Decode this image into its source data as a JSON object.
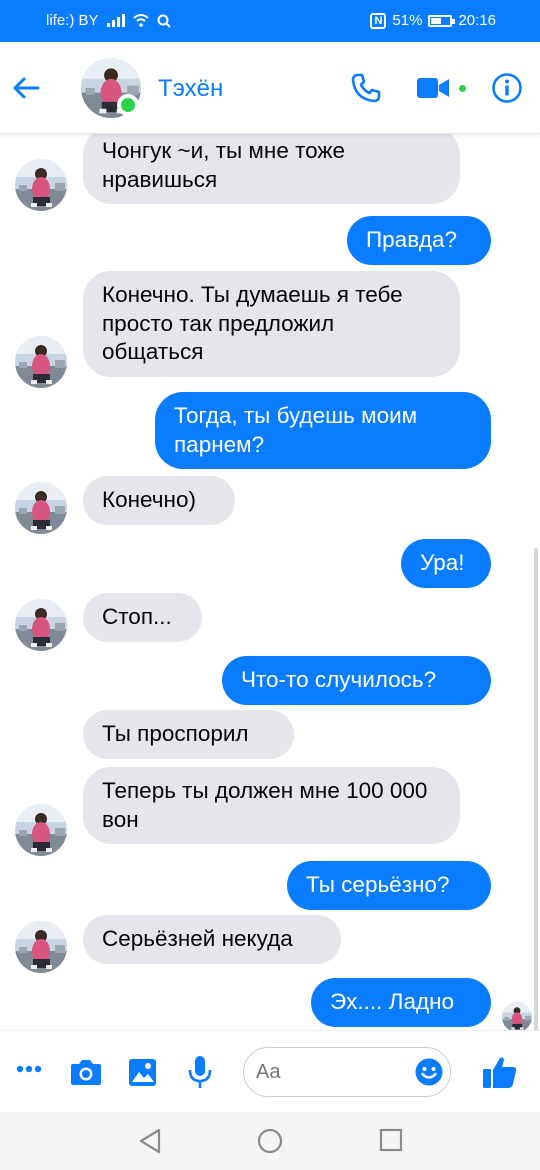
{
  "status_bar": {
    "carrier": "life:) BY",
    "battery": "51%",
    "battery_level": 0.51,
    "time": "20:16"
  },
  "header": {
    "contact_name": "Тэхён",
    "icons": [
      "back-arrow-icon",
      "phone-icon",
      "video-camera-icon",
      "info-icon"
    ]
  },
  "colors": {
    "accent": "#0a7cff",
    "incoming_bubble": "#e4e6eb",
    "online": "#2bd24a"
  },
  "messages": [
    {
      "from": "them",
      "text": "Чонгук ~и, ты мне тоже нравишься"
    },
    {
      "from": "me",
      "text": "Правда?"
    },
    {
      "from": "them",
      "text": "Конечно. Ты думаешь я тебе просто так предложил общаться"
    },
    {
      "from": "me",
      "text": "Тогда, ты будешь моим парнем?"
    },
    {
      "from": "them",
      "text": "Конечно)"
    },
    {
      "from": "me",
      "text": "Ура!"
    },
    {
      "from": "them",
      "text": "Стоп..."
    },
    {
      "from": "me",
      "text": "Что-то  случилось?"
    },
    {
      "from": "them",
      "text": "Ты проспорил"
    },
    {
      "from": "them",
      "text": "Теперь ты должен мне 100 000 вон"
    },
    {
      "from": "me",
      "text": "Ты серьёзно?"
    },
    {
      "from": "them",
      "text": "Серьёзней некуда"
    },
    {
      "from": "me",
      "text": "Эх.... Ладно"
    }
  ],
  "composer": {
    "placeholder": "Aa",
    "icons": [
      "more-icon",
      "camera-icon",
      "gallery-icon",
      "microphone-icon",
      "emoji-icon",
      "like-icon"
    ]
  },
  "nav_bar": {
    "icons": [
      "nav-back-icon",
      "nav-home-icon",
      "nav-recents-icon"
    ]
  }
}
